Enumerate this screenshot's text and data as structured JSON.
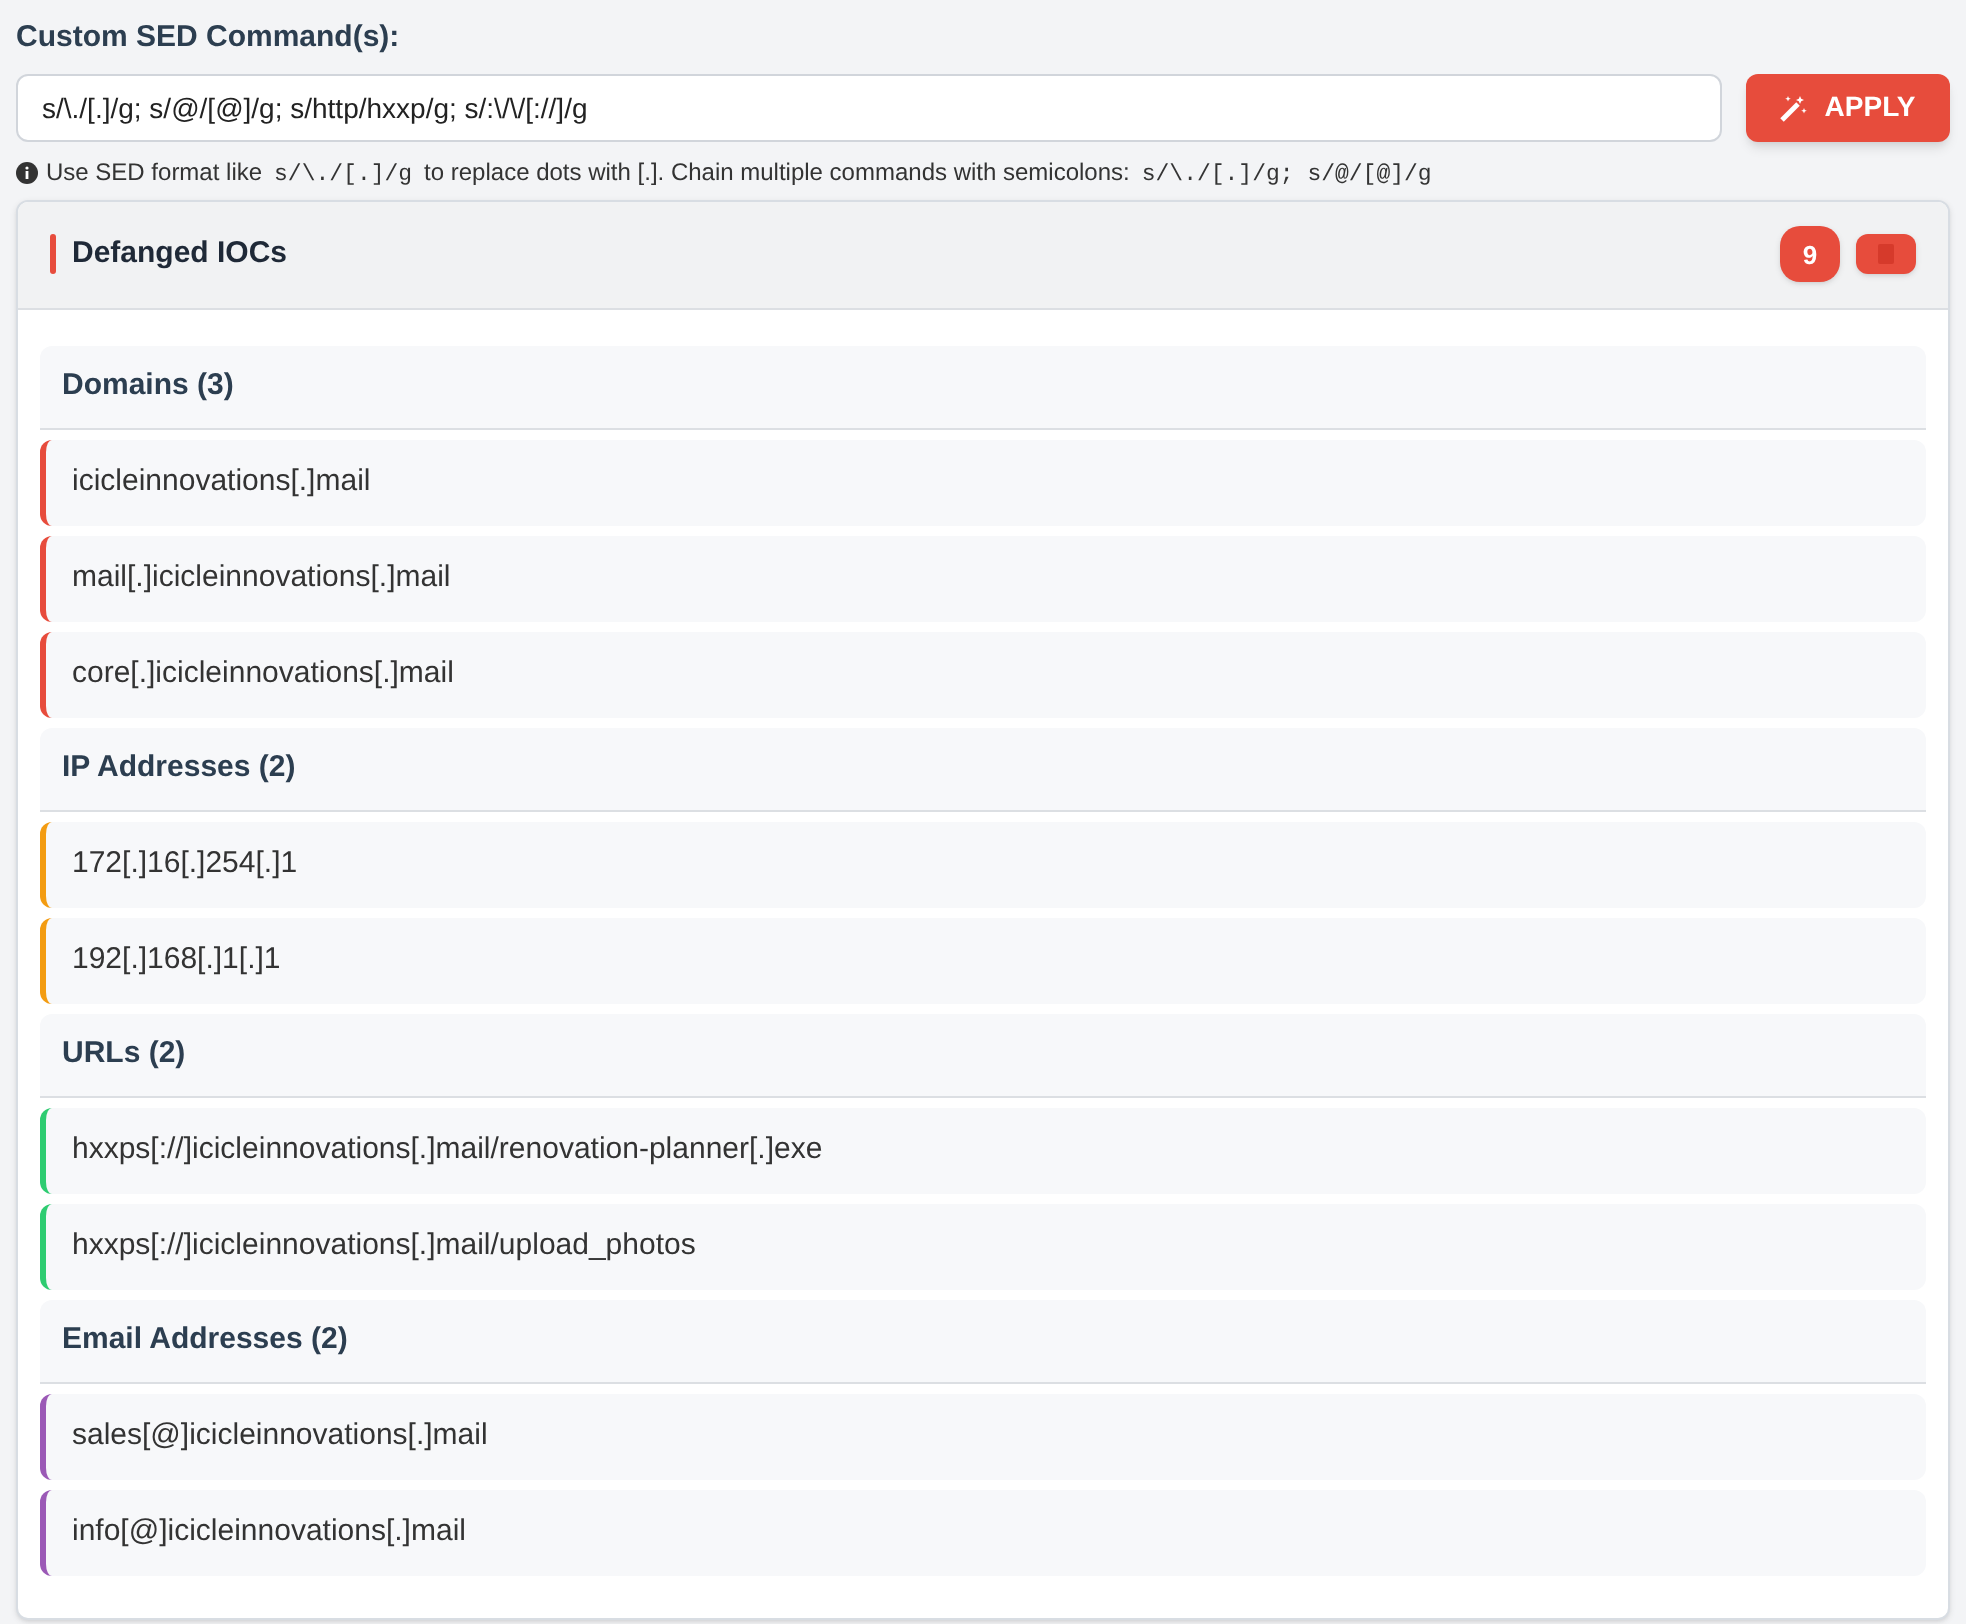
{
  "sed_label": "Custom SED Command(s):",
  "sed_value": "s/\\./[.]/g; s/@/[@]/g; s/http/hxxp/g; s/:\\/\\/[://]/g",
  "apply_button": "APPLY",
  "hint": [
    {
      "kind": "text",
      "text": "Use SED format like"
    },
    {
      "kind": "code",
      "text": "s/\\./[.]/g"
    },
    {
      "kind": "text",
      "text": "to replace dots with [.]. Chain multiple commands with semicolons:"
    },
    {
      "kind": "code",
      "text": "s/\\./[.]/g; s/@/[@]/g"
    }
  ],
  "panel": {
    "title": "Defanged IOCs",
    "count": "9"
  },
  "groups": [
    {
      "title": "Domains (3)",
      "color": "#e74c3c",
      "items": [
        "icicleinnovations[.]mail",
        "mail[.]icicleinnovations[.]mail",
        "core[.]icicleinnovations[.]mail"
      ]
    },
    {
      "title": "IP Addresses (2)",
      "color": "#f39c12",
      "items": [
        "172[.]16[.]254[.]1",
        "192[.]168[.]1[.]1"
      ]
    },
    {
      "title": "URLs (2)",
      "color": "#2ecc71",
      "items": [
        "hxxps[://]icicleinnovations[.]mail/renovation-planner[.]exe",
        "hxxps[://]icicleinnovations[.]mail/upload_photos"
      ]
    },
    {
      "title": "Email Addresses (2)",
      "color": "#9b59b6",
      "items": [
        "sales[@]icicleinnovations[.]mail",
        "info[@]icicleinnovations[.]mail"
      ]
    }
  ]
}
